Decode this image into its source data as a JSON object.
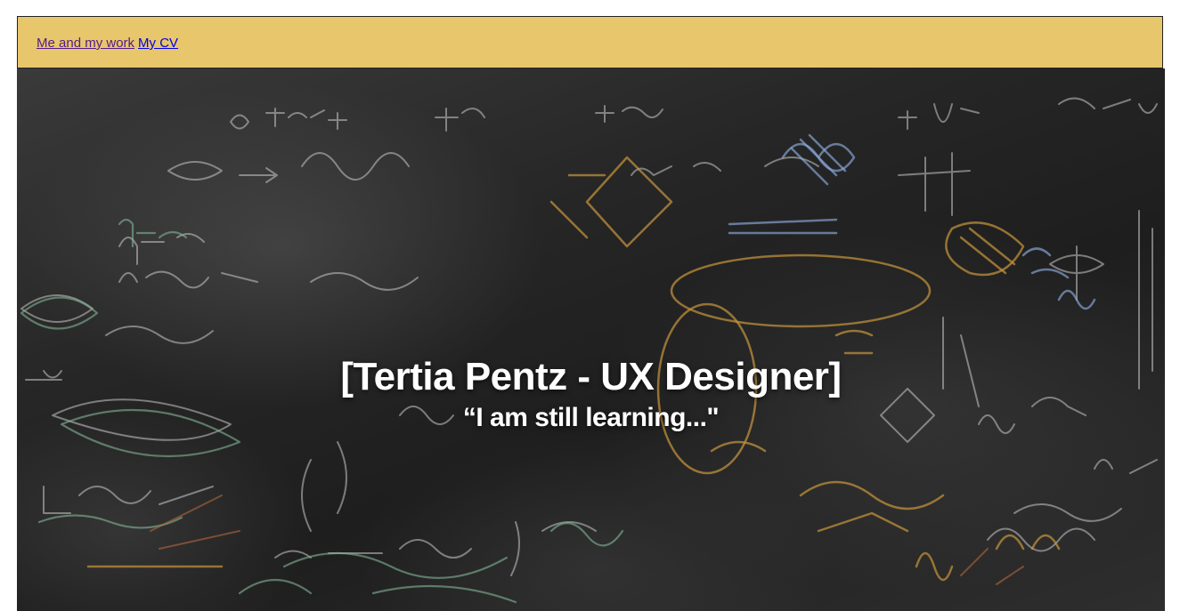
{
  "nav": {
    "links": [
      {
        "label": "Me and my work"
      },
      {
        "label": "My CV"
      }
    ],
    "background_color": "#e8c66b",
    "visited_link_color": "#551a8b",
    "link_color": "#0000ee"
  },
  "hero": {
    "title": "[Tertia Pentz - UX Designer]",
    "subtitle": "“I am still learning...\"",
    "background_image": "chalkboard-with-math-equations"
  }
}
